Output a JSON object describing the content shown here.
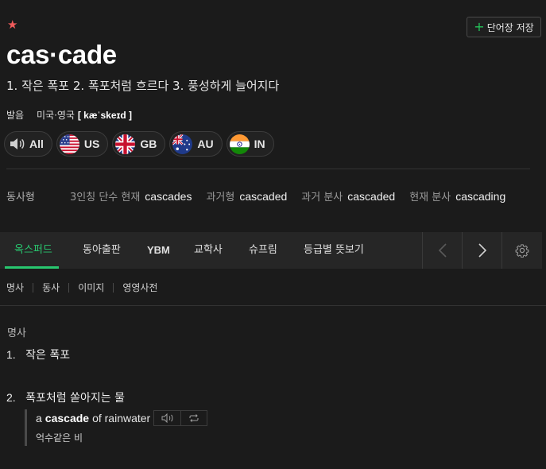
{
  "entry": {
    "headword": "cas·cade",
    "meaning_summary": "1. 작은 폭포 2. 폭포처럼 흐르다 3. 풍성하게 늘어지다",
    "save_button": "단어장 저장"
  },
  "pronunciation": {
    "label": "발음",
    "region": "미국·영국",
    "ipa": "[ kæˈskeɪd ]",
    "accents": [
      {
        "label": "All",
        "icon": "speaker-icon"
      },
      {
        "label": "US",
        "icon": "us-flag-icon"
      },
      {
        "label": "GB",
        "icon": "gb-flag-icon"
      },
      {
        "label": "AU",
        "icon": "au-flag-icon"
      },
      {
        "label": "IN",
        "icon": "in-flag-icon"
      }
    ]
  },
  "verb_forms": {
    "label": "동사형",
    "items": [
      {
        "label": "3인칭 단수 현재",
        "value": "cascades"
      },
      {
        "label": "과거형",
        "value": "cascaded"
      },
      {
        "label": "과거 분사",
        "value": "cascaded"
      },
      {
        "label": "현재 분사",
        "value": "cascading"
      }
    ]
  },
  "dictionary_tabs": [
    "옥스퍼드",
    "동아출판",
    "YBM",
    "교학사",
    "슈프림",
    "등급별 뜻보기"
  ],
  "active_tab": "옥스퍼드",
  "pos_filters": [
    "명사",
    "동사",
    "이미지",
    "영영사전"
  ],
  "definitions": {
    "part_of_speech": "명사",
    "senses": [
      {
        "num": "1.",
        "text": "작은 폭포"
      },
      {
        "num": "2.",
        "text": "폭포처럼 쏟아지는 물"
      }
    ],
    "example": {
      "prefix": "a",
      "keyword": "cascade",
      "suffix": "of rainwater",
      "translation": "억수같은 비"
    }
  },
  "colors": {
    "background": "#1b1b1b",
    "accent_green": "#28c76f",
    "star_red": "#f05b5b"
  }
}
